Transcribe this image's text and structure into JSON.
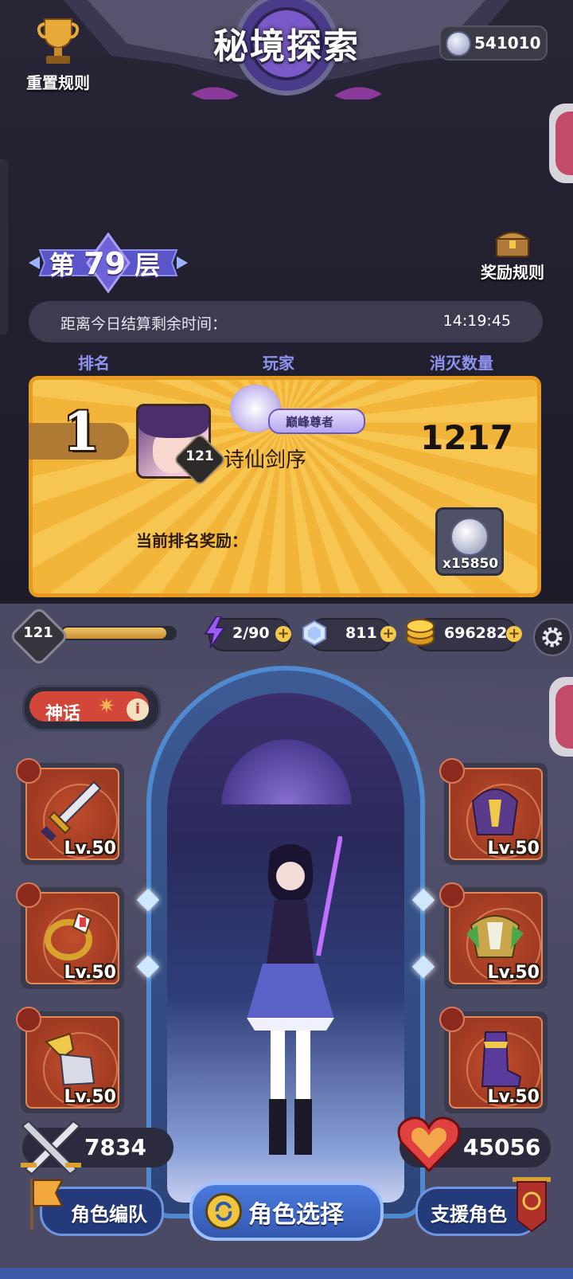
{
  "header": {
    "title": "秘境探索"
  },
  "reset_rules": {
    "label": "重置规则",
    "icon": "trophy-icon"
  },
  "currency_top": {
    "value": "541010",
    "icon": "silver-star-coin-icon"
  },
  "floor": {
    "prefix": "第",
    "number": "79",
    "suffix": "层"
  },
  "reward_rules": {
    "label": "奖励规则",
    "icon": "treasure-chest-icon"
  },
  "timer": {
    "label": "距离今日结算剩余时间：",
    "value": "14:19:45"
  },
  "columns": {
    "rank": "排名",
    "player": "玩家",
    "kills": "消灭数量"
  },
  "top_entry": {
    "rank": "1",
    "level": "121",
    "title_badge": "巅峰尊者",
    "name": "诗仙剑序",
    "kills": "1217",
    "reward_label": "当前排名奖励：",
    "reward_qty": "x15850"
  },
  "status_bar": {
    "level": "121",
    "xp_fraction": 0.92,
    "energy": "2/90",
    "gems": "811",
    "gold": "696282"
  },
  "rarity": {
    "label": "神话",
    "info": "i"
  },
  "equipment_left": [
    {
      "name": "sword",
      "level": "Lv.50"
    },
    {
      "name": "ring",
      "level": "Lv.50"
    },
    {
      "name": "gauntlet",
      "level": "Lv.50"
    }
  ],
  "equipment_right": [
    {
      "name": "helmet",
      "level": "Lv.50"
    },
    {
      "name": "armor",
      "level": "Lv.50"
    },
    {
      "name": "boots",
      "level": "Lv.50"
    }
  ],
  "stats": {
    "attack": "7834",
    "health": "45056"
  },
  "buttons": {
    "team": "角色编队",
    "select": "角色选择",
    "support": "支援角色"
  },
  "colors": {
    "accent": "#8f93f0",
    "card_gold": "#f2b439",
    "slot_red": "#b0432a",
    "button_blue": "#4a7adc"
  }
}
